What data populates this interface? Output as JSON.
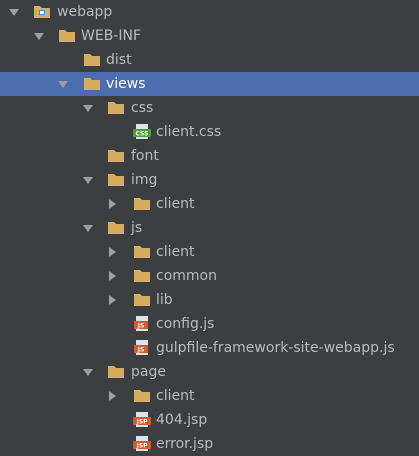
{
  "tree": {
    "root": {
      "label": "webapp",
      "icon": "module-folder-icon",
      "state": "expanded"
    },
    "webinf": {
      "label": "WEB-INF",
      "icon": "folder-icon",
      "state": "expanded"
    },
    "dist": {
      "label": "dist",
      "icon": "folder-icon"
    },
    "views": {
      "label": "views",
      "icon": "folder-icon",
      "state": "expanded",
      "selected": true
    },
    "css": {
      "label": "css",
      "icon": "folder-icon",
      "state": "expanded"
    },
    "client_css": {
      "label": "client.css",
      "icon": "css-file-icon",
      "badge": "CSS"
    },
    "font": {
      "label": "font",
      "icon": "folder-icon"
    },
    "img": {
      "label": "img",
      "icon": "folder-icon",
      "state": "expanded"
    },
    "img_client": {
      "label": "client",
      "icon": "folder-icon",
      "state": "collapsed"
    },
    "js": {
      "label": "js",
      "icon": "folder-icon",
      "state": "expanded"
    },
    "js_client": {
      "label": "client",
      "icon": "folder-icon",
      "state": "collapsed"
    },
    "js_common": {
      "label": "common",
      "icon": "folder-icon",
      "state": "collapsed"
    },
    "js_lib": {
      "label": "lib",
      "icon": "folder-icon",
      "state": "collapsed"
    },
    "config_js": {
      "label": "config.js",
      "icon": "js-file-icon",
      "badge": "JS"
    },
    "gulpfile_js": {
      "label": "gulpfile-framework-site-webapp.js",
      "icon": "js-file-icon",
      "badge": "JS"
    },
    "page": {
      "label": "page",
      "icon": "folder-icon",
      "state": "expanded"
    },
    "page_client": {
      "label": "client",
      "icon": "folder-icon",
      "state": "collapsed"
    },
    "jsp_404": {
      "label": "404.jsp",
      "icon": "jsp-file-icon",
      "badge": "JSP"
    },
    "error_jsp": {
      "label": "error.jsp",
      "icon": "jsp-file-icon",
      "badge": "JSP"
    }
  },
  "colors": {
    "background": "#3c3f41",
    "selection": "#4b6eaf",
    "text": "#bbbbbb",
    "folder": "#d6ad5e",
    "css_badge": "#4f9a3a",
    "js_badge": "#d15a2c",
    "jsp_badge": "#d15a2c"
  }
}
